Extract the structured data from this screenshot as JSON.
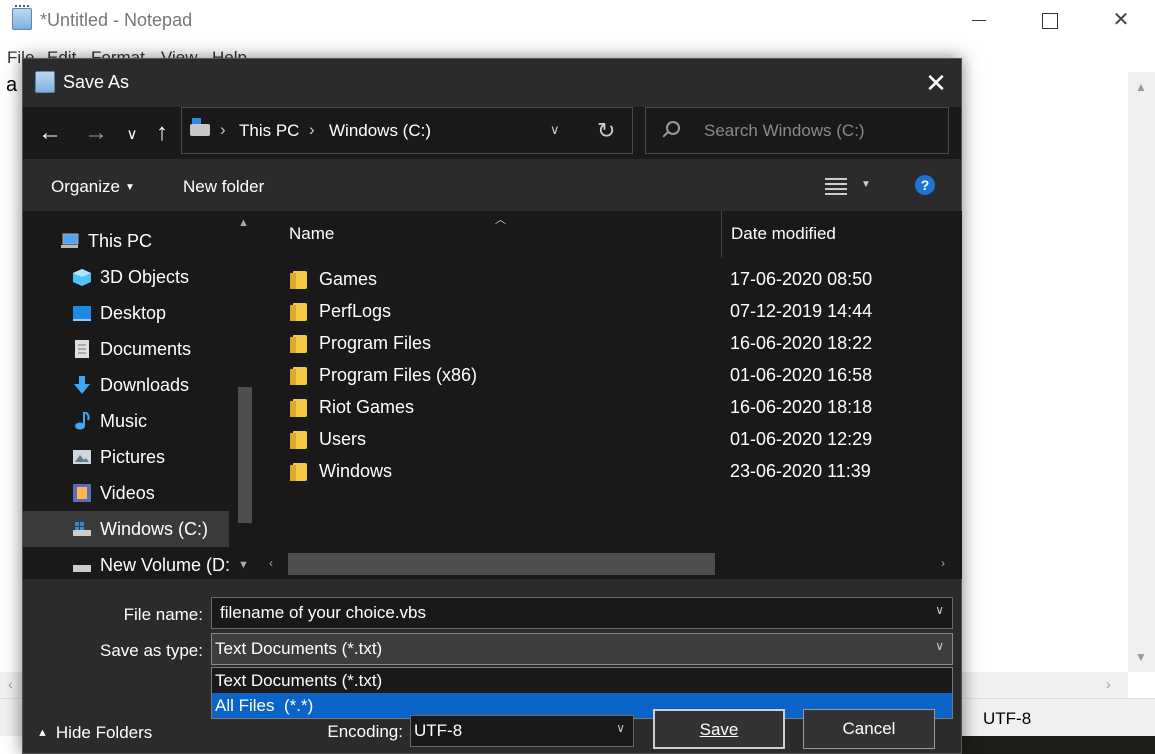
{
  "notepad": {
    "title": "*Untitled - Notepad",
    "menu": [
      "File",
      "Edit",
      "Format",
      "View",
      "Help"
    ],
    "text_content": "a",
    "status_encoding": "UTF-8"
  },
  "dialog": {
    "title": "Save As",
    "address": {
      "parts": [
        "This PC",
        "Windows (C:)"
      ]
    },
    "search_placeholder": "Search Windows (C:)",
    "toolbar": {
      "organize": "Organize",
      "new_folder": "New folder"
    },
    "nav_pane": {
      "items": [
        {
          "label": "This PC",
          "icon": "computer-icon"
        },
        {
          "label": "3D Objects",
          "icon": "cube-icon"
        },
        {
          "label": "Desktop",
          "icon": "desktop-icon"
        },
        {
          "label": "Documents",
          "icon": "document-icon"
        },
        {
          "label": "Downloads",
          "icon": "download-arrow-icon"
        },
        {
          "label": "Music",
          "icon": "music-note-icon"
        },
        {
          "label": "Pictures",
          "icon": "picture-icon"
        },
        {
          "label": "Videos",
          "icon": "film-icon"
        },
        {
          "label": "Windows (C:)",
          "icon": "system-drive-icon",
          "selected": true
        },
        {
          "label": "New Volume (D:)",
          "icon": "drive-icon"
        }
      ]
    },
    "columns": {
      "name": "Name",
      "date_modified": "Date modified"
    },
    "files": [
      {
        "name": "Games",
        "date": "17-06-2020 08:50"
      },
      {
        "name": "PerfLogs",
        "date": "07-12-2019 14:44"
      },
      {
        "name": "Program Files",
        "date": "16-06-2020 18:22"
      },
      {
        "name": "Program Files (x86)",
        "date": "01-06-2020 16:58"
      },
      {
        "name": "Riot Games",
        "date": "16-06-2020 18:18"
      },
      {
        "name": "Users",
        "date": "01-06-2020 12:29"
      },
      {
        "name": "Windows",
        "date": "23-06-2020 11:39"
      }
    ],
    "form": {
      "file_name_label": "File name:",
      "file_name_value": "filename of your choice.vbs",
      "save_as_type_label": "Save as type:",
      "save_as_type_value": "Text Documents (*.txt)",
      "type_options": [
        "Text Documents (*.txt)",
        "All Files  (*.*)"
      ],
      "highlighted_option": "All Files  (*.*)",
      "encoding_label": "Encoding:",
      "encoding_value": "UTF-8"
    },
    "buttons": {
      "hide_folders": "Hide Folders",
      "save": "Save",
      "cancel": "Cancel"
    }
  },
  "colors": {
    "dialog_bg": "#2b2b2b",
    "pane_bg": "#191919",
    "highlight": "#0a64c8",
    "folder": "#f7c948"
  }
}
